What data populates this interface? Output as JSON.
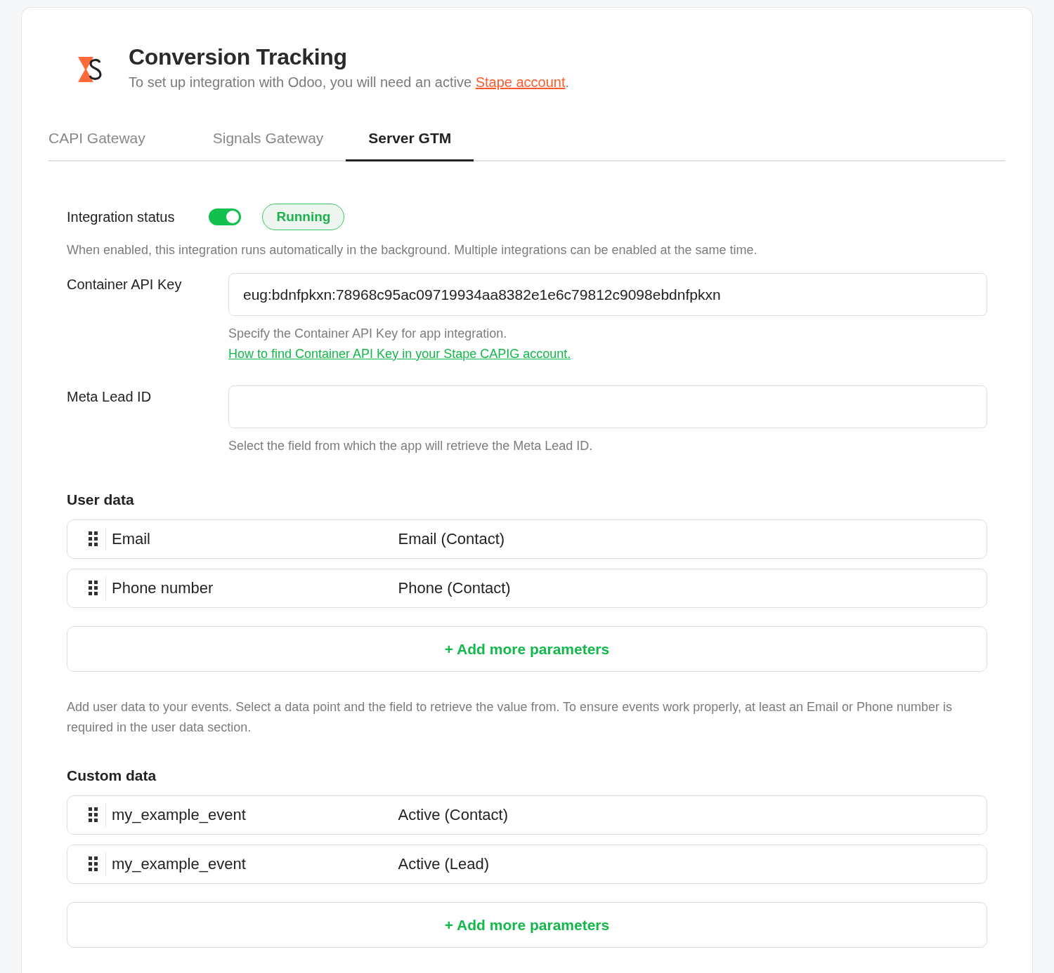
{
  "header": {
    "title": "Conversion Tracking",
    "subtitle_before": "To set up integration with Odoo, you will need an active ",
    "subtitle_link": "Stape account",
    "subtitle_after": "."
  },
  "tabs": [
    {
      "label": "CAPI Gateway",
      "selected": false
    },
    {
      "label": "Signals Gateway",
      "selected": false
    },
    {
      "label": "Server GTM",
      "selected": true
    }
  ],
  "integration_status": {
    "label": "Integration status",
    "on": true,
    "badge": "Running",
    "help": "When enabled, this integration runs automatically in the background. Multiple integrations can be enabled at the same time."
  },
  "fields": [
    {
      "label": "Container API Key",
      "value": "eug:bdnfpkxn:78968c95ac09719934aa8382e1e6c79812c9098ebdnfpkxn",
      "help": "Specify the Container API Key for app integration.",
      "link": "How to find Container API Key in your Stape CAPIG account."
    },
    {
      "label": "Meta Lead ID",
      "help": "Select the field from which the app will retrieve the Meta Lead ID."
    }
  ],
  "sections": [
    {
      "title": "User data",
      "rows": [
        {
          "name": "Email",
          "source": "Email (Contact)"
        },
        {
          "name": "Phone number",
          "source": "Phone (Contact)"
        }
      ],
      "add_button": "+ Add more parameters",
      "help": "Add user data to your events. Select a data point and the field to retrieve the value from. To ensure events work properly, at least an Email or Phone number is required in the user data section."
    },
    {
      "title": "Custom data",
      "rows": [
        {
          "name": "my_example_event",
          "source": "Active (Contact)"
        },
        {
          "name": "my_example_event",
          "source": "Active (Lead)"
        }
      ],
      "add_button": "+ Add more parameters"
    }
  ]
}
